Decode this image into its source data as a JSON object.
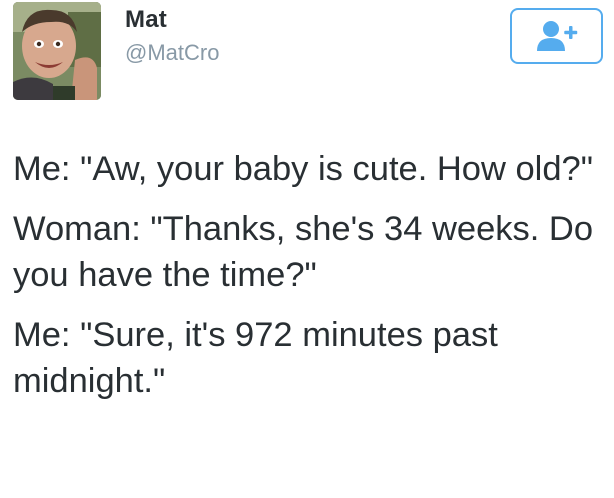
{
  "user": {
    "display_name": "Mat",
    "handle": "@MatCro",
    "avatar_icon": "profile-photo"
  },
  "follow_button": {
    "icon": "add-user-icon",
    "accent_color": "#55acee"
  },
  "tweet": {
    "paragraphs": [
      "Me: \"Aw, your baby is cute. How old?\"",
      "Woman: \"Thanks, she's 34 weeks. Do you have the time?\"",
      "Me: \"Sure, it's 972 minutes past midnight.\""
    ]
  }
}
